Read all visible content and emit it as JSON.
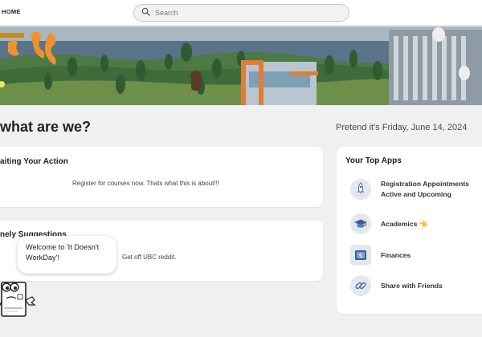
{
  "header": {
    "home_label": "HOME",
    "search_placeholder": "Search",
    "search_icon": "search-icon"
  },
  "page": {
    "title": "what are we?",
    "date_text": "Pretend it's Friday, June 14, 2024"
  },
  "awaiting_card": {
    "title": "aiting Your Action",
    "text": "Register for courses now. Thats what this is about!!!"
  },
  "suggestions_card": {
    "title": "nely Suggestions",
    "text": "Get off UBC reddit."
  },
  "top_apps": {
    "title": "Your Top Apps",
    "items": [
      {
        "line1": "Registration Appointments",
        "line2": "Active and Upcoming",
        "icon": "rocket-icon"
      },
      {
        "line1": "Academics 👈",
        "icon": "graduation-cap-icon"
      },
      {
        "line1": "Finances",
        "icon": "dollar-screen-icon"
      },
      {
        "line1": "Share with Friends",
        "icon": "link-icon"
      }
    ]
  },
  "mascot": {
    "bubble_text": "Welcome to 'It Doesn't WorkDay'!",
    "icon": "id-card-mascot-icon"
  },
  "colors": {
    "background": "#eef0f2",
    "card": "#ffffff",
    "sky": "#a9b7c0",
    "water": "#5b7389",
    "forest": "#3f6b3b",
    "orange_accent": "#f0922b"
  }
}
